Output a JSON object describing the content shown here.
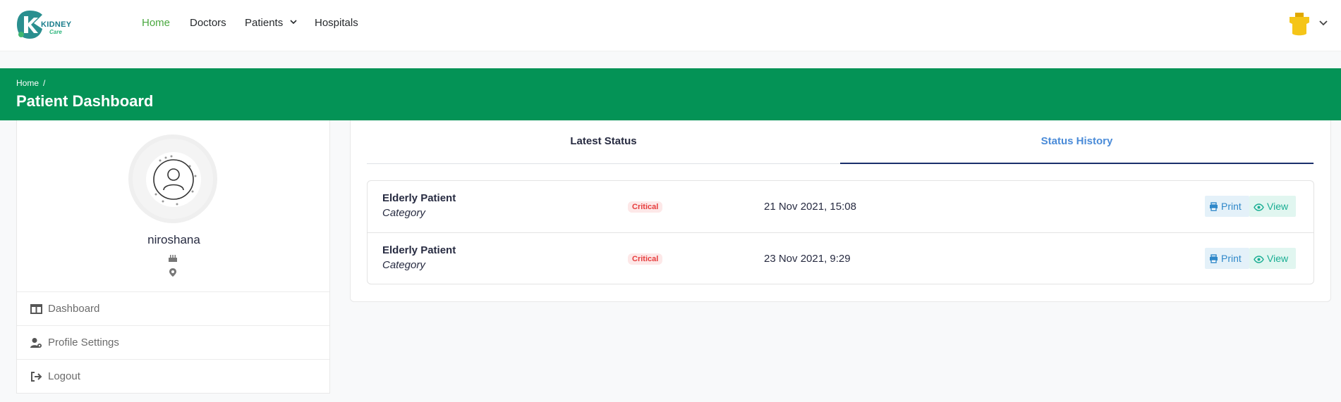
{
  "header": {
    "logo_text": "KIDNEY",
    "logo_subtext": "Care",
    "nav": [
      {
        "label": "Home",
        "active": true
      },
      {
        "label": "Doctors"
      },
      {
        "label": "Patients"
      },
      {
        "label": "Hospitals"
      }
    ],
    "accent_color": "#4aa83f"
  },
  "banner": {
    "breadcrumb": "Home",
    "breadcrumb_sep": "/",
    "title": "Patient Dashboard",
    "color": "#049356"
  },
  "profile": {
    "name": "niroshana",
    "menu": [
      {
        "label": "Dashboard",
        "icon": "columns-icon"
      },
      {
        "label": "Profile Settings",
        "icon": "user-cog-icon"
      },
      {
        "label": "Logout",
        "icon": "sign-out-icon"
      }
    ]
  },
  "status": {
    "tabs": [
      {
        "label": "Latest Status"
      },
      {
        "label": "Status History",
        "active": true
      }
    ],
    "history": [
      {
        "category": "Elderly Patient",
        "category_label": "Category",
        "badge": "Critical",
        "date": "21 Nov 2021, 15:08",
        "print": "Print",
        "view": "View"
      },
      {
        "category": "Elderly Patient",
        "category_label": "Category",
        "badge": "Critical",
        "date": "23 Nov 2021, 9:29",
        "print": "Print",
        "view": "View"
      }
    ]
  }
}
